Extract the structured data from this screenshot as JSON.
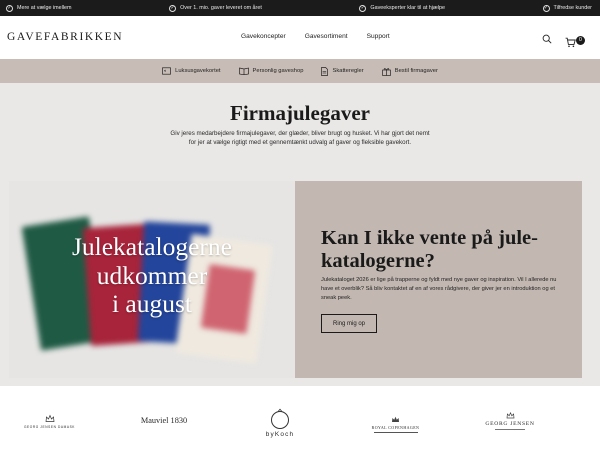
{
  "topbar": {
    "usps": [
      "Mere at vælge imellem",
      "Over 1. mio. gaver leveret om året",
      "Gaveeksperter klar til at hjælpe",
      "Tilfredse kunder"
    ]
  },
  "header": {
    "logo": "GAVEFABRIKKEN",
    "nav": [
      "Gavekoncepter",
      "Gavesortiment",
      "Support"
    ],
    "cart_count": "0"
  },
  "subnav": {
    "items": [
      "Luksusgavekortet",
      "Personlig gaveshop",
      "Skatteregler",
      "Bestil firmagaver"
    ]
  },
  "main": {
    "title": "Firmajulegaver",
    "intro": "Giv jeres medarbejdere firmajulegaver, der glæder, bliver brugt og husket. Vi har gjort det nemt for jer at vælge rigtigt med et gennemtænkt udvalg af gaver og fleksible gavekort."
  },
  "banner": {
    "image_line1": "Julekatalogerne",
    "image_line2": "udkommer",
    "image_line3": "i august",
    "heading": "Kan I ikke vente på jule-kataloger ne?",
    "heading_line1": "Kan I ikke vente på jule-",
    "heading_line2": "katalogerne?",
    "body": "Julekataloget 2026 er lige på trapperne og fyldt med nye gaver og inspiration. Vil I allerede nu have et overblik? Så bliv kontaktet af en af vores rådgivere, der giver jer en introduktion og et sneak peek.",
    "button": "Ring mig op"
  },
  "brands": {
    "b1": "GEORG JENSEN DAMASK",
    "b2": "Mauviel 1830",
    "b3": "byKoch",
    "b4": "ROYAL COPENHAGEN",
    "b5": "GEORG JENSEN"
  },
  "colors": {
    "topbar": "#1b1b1b",
    "subnav": "#c8bdb6",
    "main_bg": "#eae8e7",
    "panel": "#c2b8b1"
  }
}
